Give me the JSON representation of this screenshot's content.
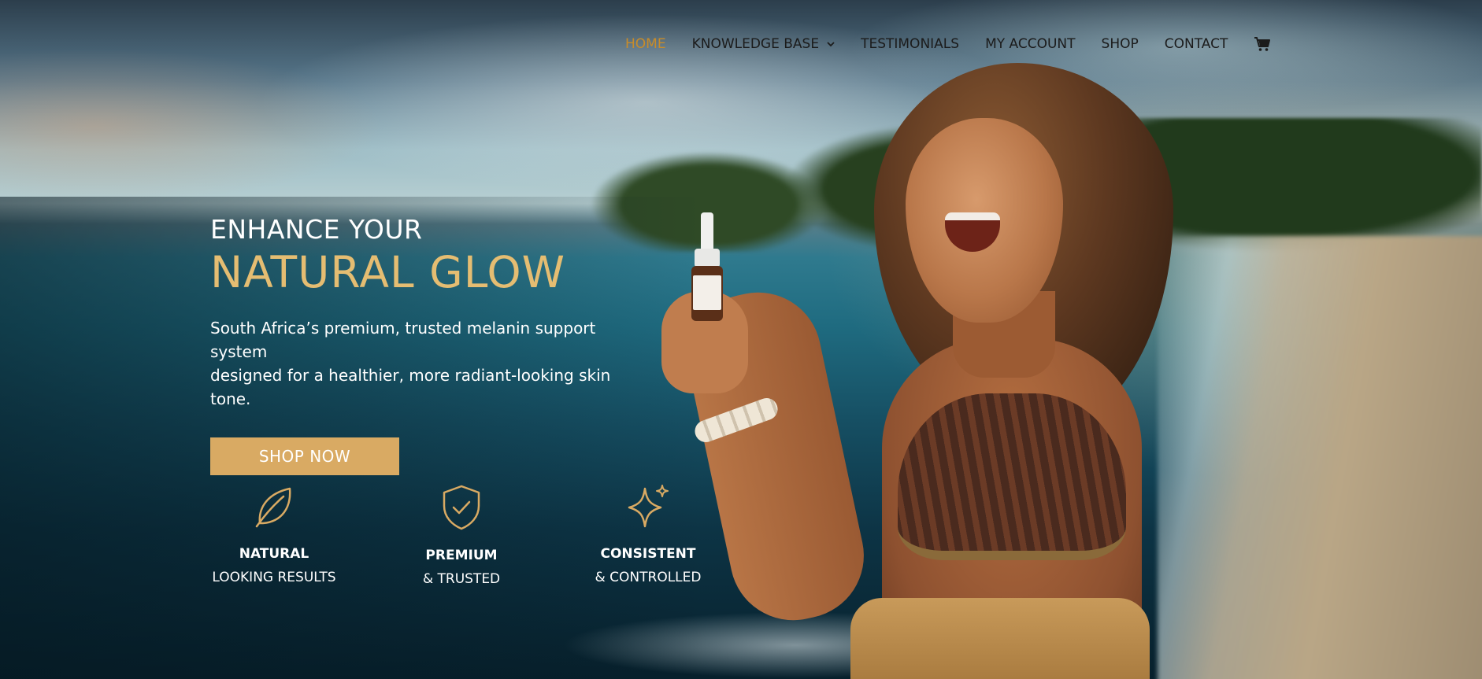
{
  "nav": {
    "items": [
      {
        "label": "HOME",
        "active": true
      },
      {
        "label": "KNOWLEDGE BASE",
        "has_dropdown": true
      },
      {
        "label": "TESTIMONIALS"
      },
      {
        "label": "MY ACCOUNT"
      },
      {
        "label": "SHOP"
      },
      {
        "label": "CONTACT"
      }
    ],
    "cart_icon": "shopping-cart-icon",
    "active_color": "#c88c2a"
  },
  "hero": {
    "eyebrow": "ENHANCE YOUR",
    "headline": "NATURAL GLOW",
    "subtext_line1": "South Africa’s premium, trusted melanin support system",
    "subtext_line2": "designed for a healthier, more radiant-looking skin tone.",
    "cta_label": "SHOP NOW",
    "accent_color": "#e5bd72",
    "button_color": "#d9aa63"
  },
  "features": [
    {
      "icon": "leaf-icon",
      "title": "NATURAL",
      "subtitle": "LOOKING RESULTS"
    },
    {
      "icon": "shield-check-icon",
      "title": "PREMIUM",
      "subtitle": "& TRUSTED"
    },
    {
      "icon": "sparkle-icon",
      "title": "CONSISTENT",
      "subtitle": "& CONTROLLED"
    }
  ]
}
